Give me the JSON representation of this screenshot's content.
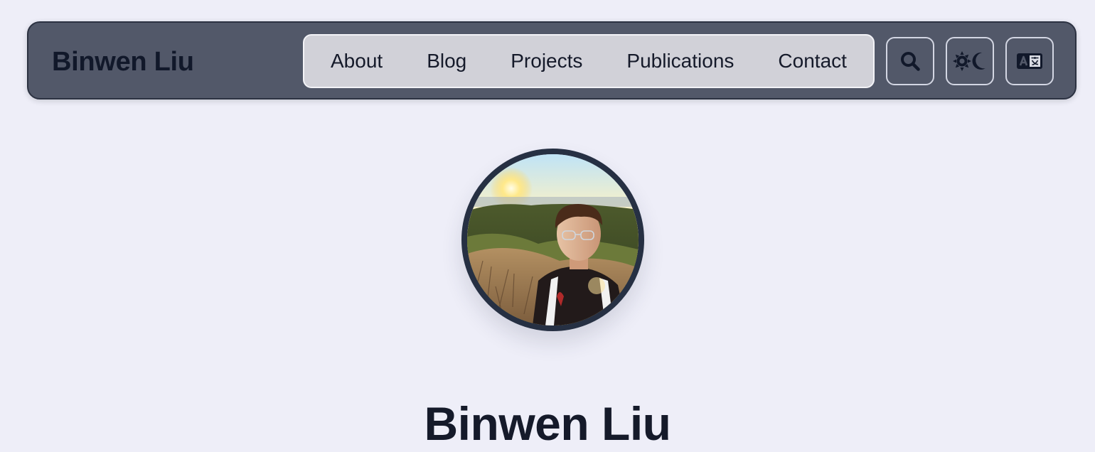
{
  "site": {
    "brand": "Binwen Liu"
  },
  "nav": {
    "links": [
      {
        "label": "About"
      },
      {
        "label": "Blog"
      },
      {
        "label": "Projects"
      },
      {
        "label": "Publications"
      },
      {
        "label": "Contact"
      }
    ]
  },
  "toolbar": {
    "search_icon": "search-icon",
    "theme_icon": "sun-moon-icon",
    "language_icon": "translate-icon"
  },
  "hero": {
    "name": "Binwen Liu"
  },
  "colors": {
    "page_background": "#eeeef8",
    "navbar_background": "#525869",
    "nav_pill_background": "#d1d1d8",
    "text_dark": "#151a2a",
    "avatar_border": "#263043"
  }
}
